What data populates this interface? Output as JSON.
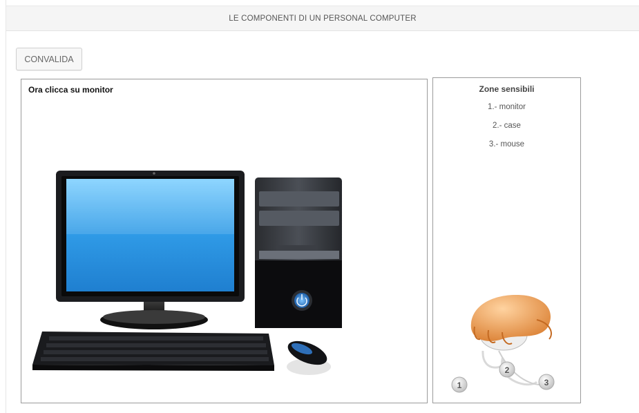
{
  "header": {
    "title": "LE COMPONENTI DI UN PERSONAL COMPUTER"
  },
  "toolbar": {
    "validate_label": "CONVALIDA"
  },
  "activity": {
    "instruction": "Ora clicca su monitor",
    "hotspots": [
      {
        "icon": "monitor-icon"
      },
      {
        "icon": "case-icon"
      },
      {
        "icon": "mouse-icon"
      }
    ]
  },
  "zones": {
    "title": "Zone sensibili",
    "items": [
      {
        "label": "1.- monitor"
      },
      {
        "label": "2.- case"
      },
      {
        "label": "3.- mouse"
      }
    ],
    "legend_numbers": [
      "1",
      "2",
      "3"
    ]
  },
  "colors": {
    "screen": "#3aa0e8",
    "panel_border": "#9a9a9a",
    "title_bg": "#f5f5f5",
    "hand": "#f0a868"
  }
}
